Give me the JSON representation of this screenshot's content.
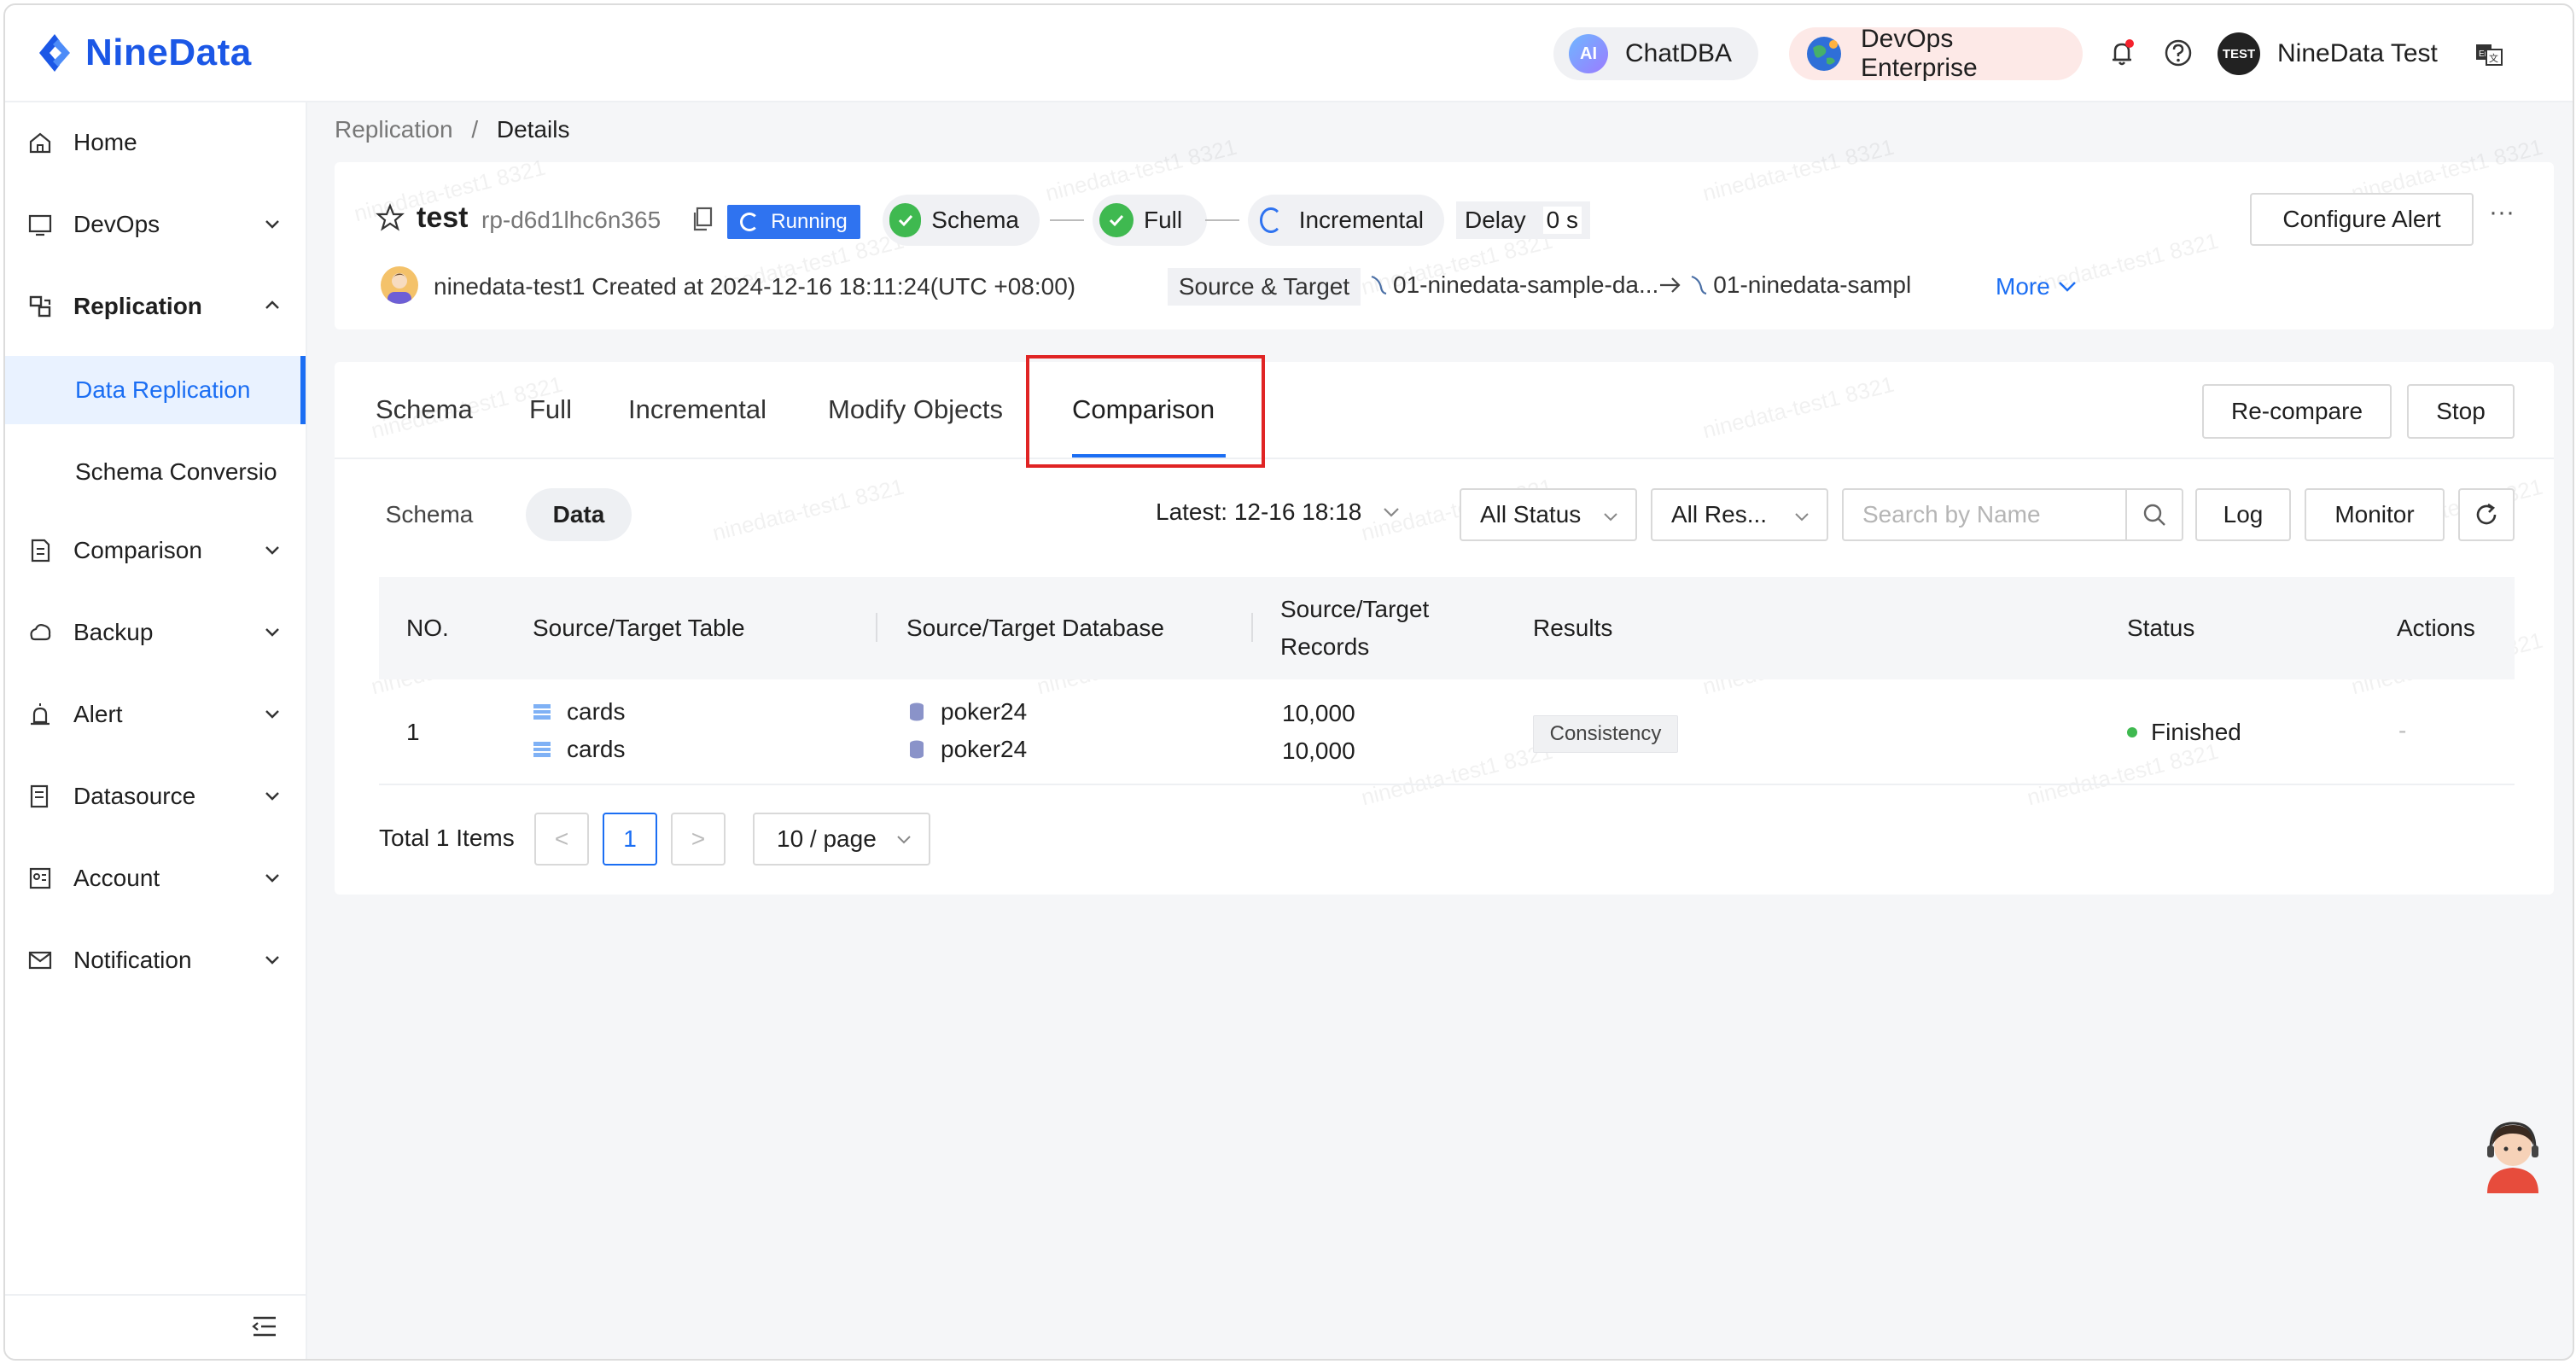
{
  "header": {
    "brand": "NineData",
    "chatdba_label": "ChatDBA",
    "chatdba_badge": "AI",
    "devops_label": "DevOps Enterprise",
    "user_avatar_text": "TEST",
    "user_name": "NineData Test"
  },
  "sidebar": {
    "items": [
      {
        "label": "Home"
      },
      {
        "label": "DevOps"
      },
      {
        "label": "Replication"
      },
      {
        "label": "Comparison"
      },
      {
        "label": "Backup"
      },
      {
        "label": "Alert"
      },
      {
        "label": "Datasource"
      },
      {
        "label": "Account"
      },
      {
        "label": "Notification"
      }
    ],
    "sub_items": [
      {
        "label": "Data Replication"
      },
      {
        "label": "Schema Conversio"
      }
    ]
  },
  "breadcrumb": {
    "parent": "Replication",
    "sep": "/",
    "current": "Details"
  },
  "task": {
    "name": "test",
    "id": "rp-d6d1lhc6n365",
    "status": "Running",
    "stages": [
      "Schema",
      "Full",
      "Incremental"
    ],
    "delay_label": "Delay",
    "delay_value": "0 s",
    "owner": "ninedata-test1",
    "created": "Created at 2024-12-16 18:11:24(UTC +08:00)",
    "source_target_label": "Source & Target",
    "source": "01-ninedata-sample-da...",
    "target": "01-ninedata-sampl",
    "more_label": "More",
    "configure_alert": "Configure Alert",
    "more_dots": "···"
  },
  "tabs": [
    "Schema",
    "Full",
    "Incremental",
    "Modify Objects",
    "Comparison"
  ],
  "actions": {
    "recompare": "Re-compare",
    "stop": "Stop"
  },
  "subtabs": {
    "schema": "Schema",
    "data": "Data"
  },
  "filters": {
    "latest": "Latest: 12-16 18:18",
    "status": "All Status",
    "results": "All Res...",
    "search_placeholder": "Search by Name",
    "log": "Log",
    "monitor": "Monitor"
  },
  "table": {
    "headers": {
      "no": "NO.",
      "table": "Source/Target Table",
      "database": "Source/Target Database",
      "records_1": "Source/Target",
      "records_2": "Records",
      "results": "Results",
      "status": "Status",
      "actions": "Actions"
    },
    "rows": [
      {
        "no": "1",
        "source_table": "cards",
        "target_table": "cards",
        "source_db": "poker24",
        "target_db": "poker24",
        "source_records": "10,000",
        "target_records": "10,000",
        "result": "Consistency",
        "status": "Finished",
        "action": "-"
      }
    ]
  },
  "pagination": {
    "total": "Total 1 Items",
    "prev": "<",
    "page": "1",
    "next": ">",
    "page_size": "10 / page"
  },
  "watermark": "ninedata-test1 8321",
  "colors": {
    "brand": "#1b57e6",
    "primary": "#1b6ef3",
    "success": "#3fb950",
    "highlight": "#e02424"
  }
}
